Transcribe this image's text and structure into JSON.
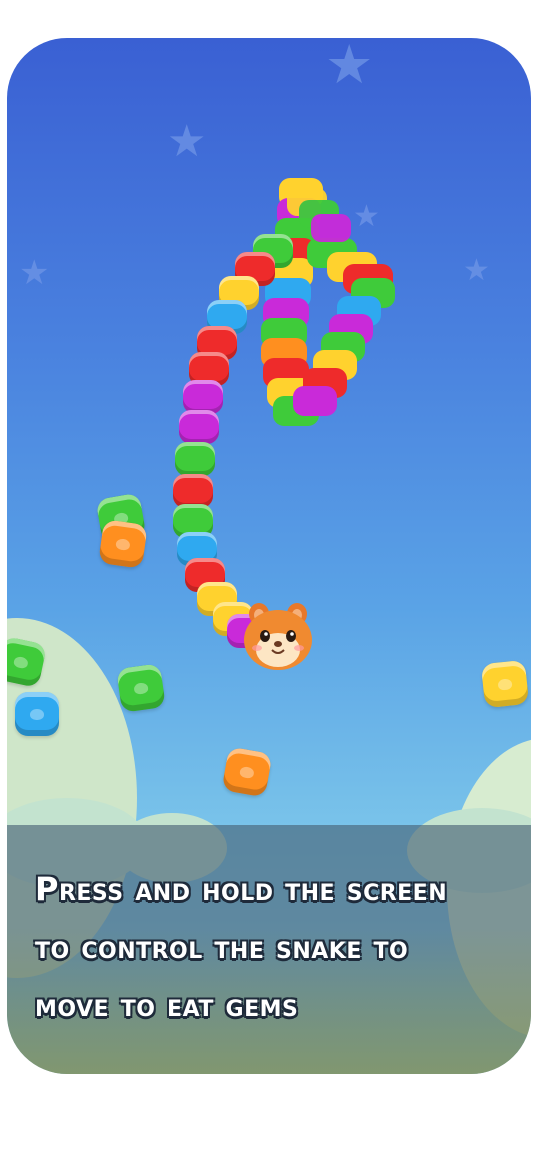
{
  "caption": {
    "line1": "Press and hold the screen",
    "line2": "to control the snake to",
    "line3": "move to eat gems"
  },
  "colors": {
    "sky_top": "#3a60d3",
    "sky_bottom": "#9ed7ee",
    "gem_green": "#3fcb3a",
    "gem_orange": "#ff8f1f",
    "gem_blue": "#2fa9f0",
    "gem_yellow": "#ffd22e",
    "gem_red": "#ee2b2b",
    "gem_purple": "#c92ad9",
    "panel_overlay": "#465f73",
    "caption_text": "#ffffff"
  },
  "icons": {
    "background_star": "star-icon",
    "snake_head": "hamster-head-icon",
    "gem": "jelly-gem-icon"
  }
}
